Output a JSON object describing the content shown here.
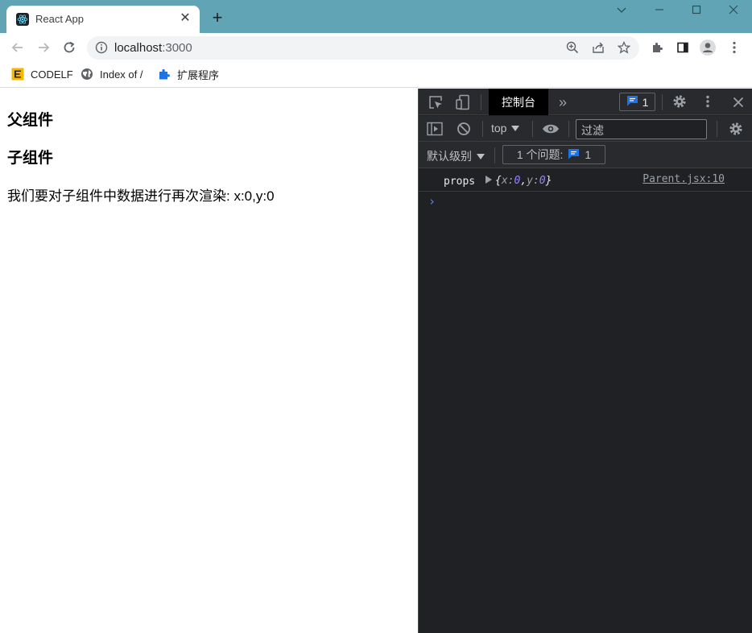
{
  "browser": {
    "tab_title": "React App",
    "tab_close": "✕",
    "new_tab": "+",
    "url_host": "localhost",
    "url_port": ":3000"
  },
  "bookmarks": [
    {
      "label": "CODELF",
      "icon": "codelf-icon"
    },
    {
      "label": "Index of /",
      "icon": "globe-icon"
    },
    {
      "label": "扩展程序",
      "icon": "puzzle-icon"
    }
  ],
  "page": {
    "parent_heading": "父组件",
    "child_heading": "子组件",
    "child_text": "我们要对子组件中数据进行再次渲染: x:0,y:0"
  },
  "devtools": {
    "active_tab": "控制台",
    "more_tabs": "»",
    "issues_count": "1",
    "context": "top",
    "filter_placeholder": "过滤",
    "level": "默认级别",
    "issues_label": "1 个问题:",
    "issues_label_count": "1",
    "log": {
      "message": "props",
      "object_open": "{",
      "key_x": "x",
      "val_x": "0",
      "key_y": "y",
      "val_y": "0",
      "object_close": "}",
      "source": "Parent.jsx:10"
    },
    "prompt": "›"
  },
  "colors": {
    "titlebar": "#61a4b5",
    "devtools_bg": "#202124",
    "accent_blue": "#1a73e8"
  }
}
